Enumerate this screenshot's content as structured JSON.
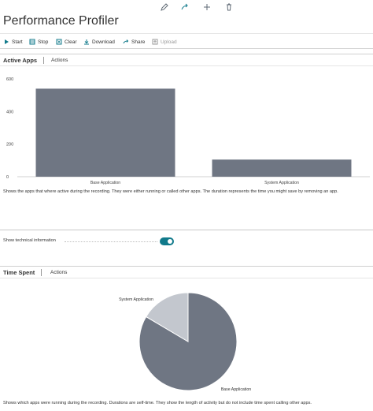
{
  "page": {
    "title": "Performance Profiler"
  },
  "top_icons": [
    "pencil-icon",
    "share-icon",
    "plus-icon",
    "trash-icon"
  ],
  "toolbar": {
    "start": "Start",
    "stop": "Stop",
    "clear": "Clear",
    "download": "Download",
    "share": "Share",
    "upload": "Upload"
  },
  "active_apps": {
    "title": "Active Apps",
    "actions": "Actions",
    "description": "Shows the apps that where active during the recording. They were either running or called other apps. The duration represents the time you might save by removing an app."
  },
  "technical": {
    "label": "Show technical information",
    "enabled": true
  },
  "time_spent": {
    "title": "Time Spent",
    "actions": "Actions",
    "description": "Shows which apps were running during the recording. Durations are self-time. They show the length of activity but do not include time spent calling other apps."
  },
  "colors": {
    "bar": "#6f7683",
    "pie_base": "#6f7683",
    "pie_system": "#c3c7ce",
    "accent": "#117a8b"
  },
  "chart_data": [
    {
      "type": "bar",
      "categories": [
        "Base Application",
        "System Application"
      ],
      "values": [
        540,
        105
      ],
      "title": "",
      "xlabel": "",
      "ylabel": "",
      "ylim": [
        0,
        600
      ],
      "yticks": [
        "0",
        "200",
        "400",
        "600"
      ],
      "grid": false
    },
    {
      "type": "pie",
      "categories": [
        "Base Application",
        "System Application"
      ],
      "values": [
        83.5,
        16.5
      ],
      "title": ""
    }
  ]
}
